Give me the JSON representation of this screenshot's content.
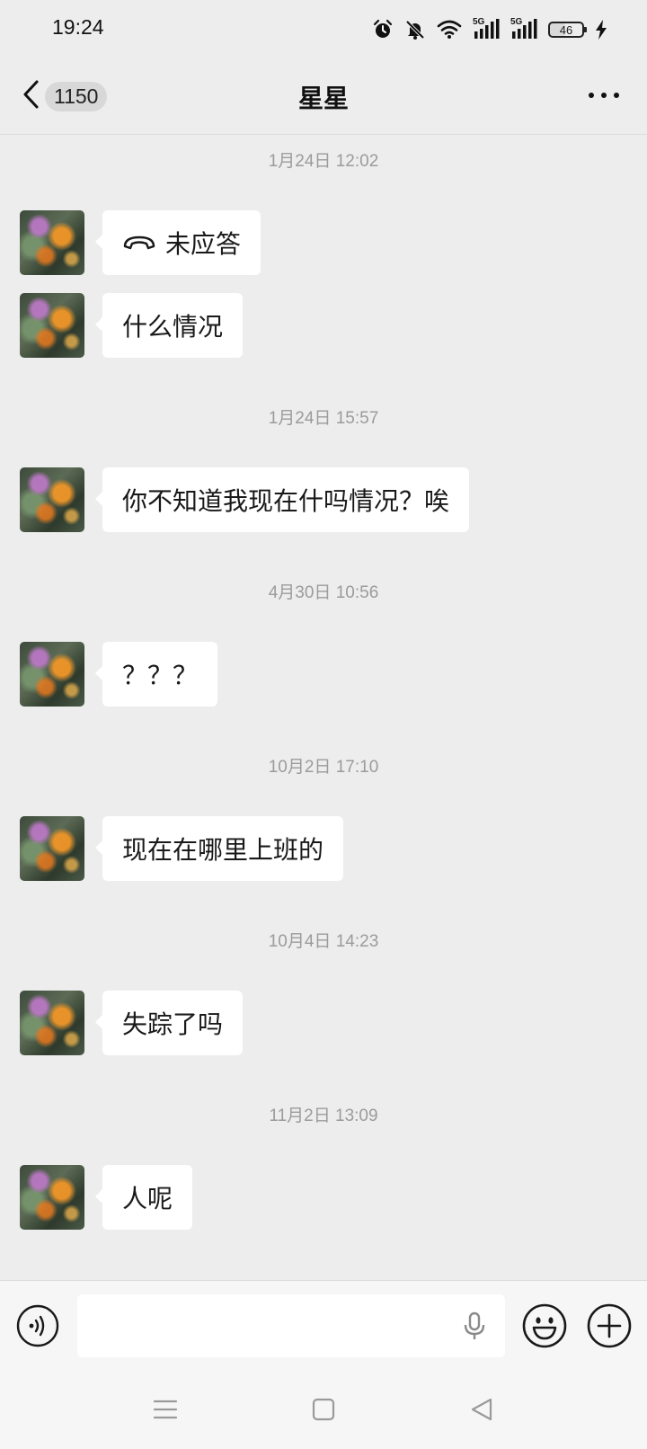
{
  "status_bar": {
    "time": "19:24",
    "network_1": "5G",
    "network_2": "5G",
    "battery": "46"
  },
  "header": {
    "unread_count": "1150",
    "title": "星星"
  },
  "messages": [
    {
      "type": "timestamp",
      "text": "1月24日 12:02"
    },
    {
      "type": "call",
      "text": "未应答"
    },
    {
      "type": "text",
      "text": "什么情况"
    },
    {
      "type": "timestamp",
      "text": "1月24日 15:57"
    },
    {
      "type": "text",
      "text": "你不知道我现在什吗情况？唉"
    },
    {
      "type": "timestamp",
      "text": "4月30日 10:56"
    },
    {
      "type": "text",
      "text": "？？？"
    },
    {
      "type": "timestamp",
      "text": "10月2日 17:10"
    },
    {
      "type": "text",
      "text": "现在在哪里上班的"
    },
    {
      "type": "timestamp",
      "text": "10月4日 14:23"
    },
    {
      "type": "text",
      "text": "失踪了吗"
    },
    {
      "type": "timestamp",
      "text": "11月2日 13:09"
    },
    {
      "type": "text",
      "text": "人呢"
    }
  ],
  "input": {
    "placeholder": ""
  },
  "icons": {
    "back": "chevron-left-icon",
    "more": "more-dots-icon",
    "call": "hang-up-phone-icon",
    "voice": "voice-wave-icon",
    "mic": "microphone-icon",
    "emoji": "smiley-icon",
    "plus": "plus-circle-icon",
    "nav_menu": "menu-lines-icon",
    "nav_home": "home-square-icon",
    "nav_back": "back-triangle-icon"
  }
}
